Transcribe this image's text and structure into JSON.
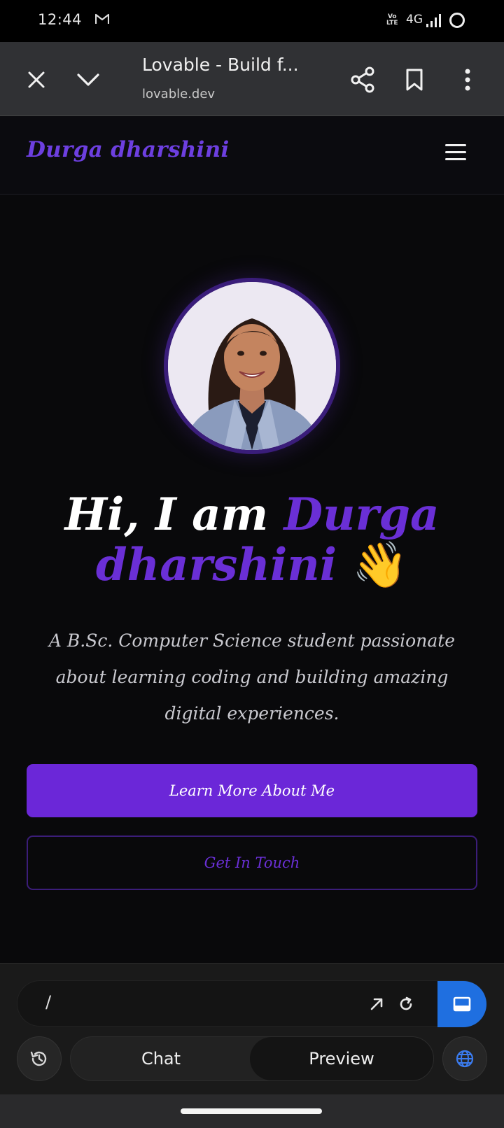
{
  "status_bar": {
    "time": "12:44",
    "volte": "Vo LTE",
    "network": "4G"
  },
  "browser": {
    "title": "Lovable - Build f...",
    "url": "lovable.dev"
  },
  "site": {
    "brand": "Durga dharshini",
    "hero": {
      "greeting": "Hi, I am",
      "name": "Durga dharshini",
      "emoji": "👋",
      "description": "A B.Sc. Computer Science student passionate about learning coding and building amazing digital experiences."
    },
    "primary_button": "Learn More About Me",
    "secondary_button": "Get In Touch"
  },
  "app_bar": {
    "path": "/",
    "tabs": [
      "Chat",
      "Preview"
    ],
    "active_tab": "Preview"
  },
  "colors": {
    "accent": "#6b27d8",
    "background": "#09090b",
    "blue": "#1f6fe0"
  }
}
